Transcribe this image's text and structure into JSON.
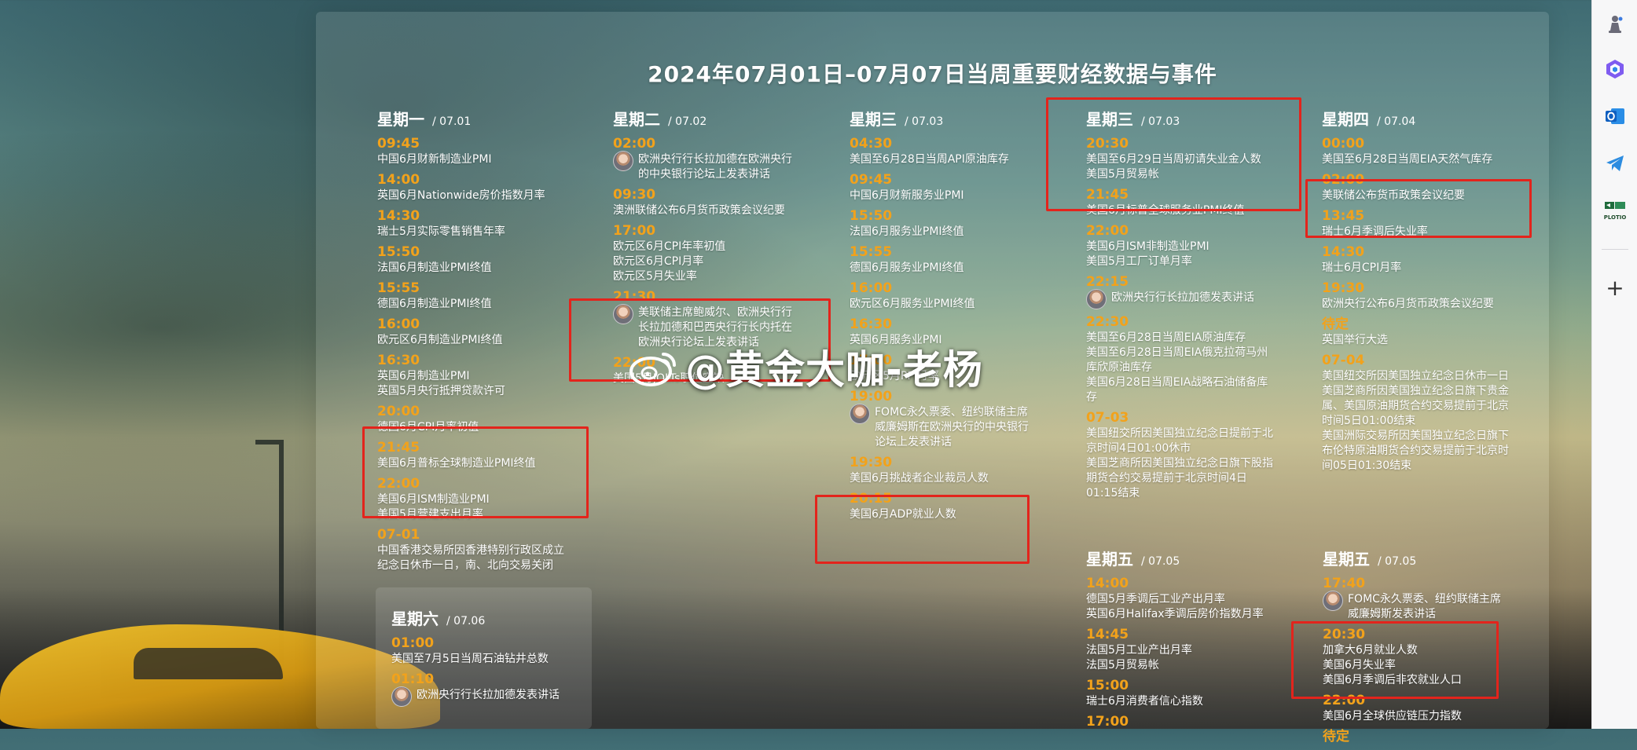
{
  "title": "2024年07月01日–07月07日当周重要财经数据与事件",
  "watermark": "@黄金大咖-老杨",
  "days": [
    {
      "key": "mon",
      "name": "星期一",
      "date": "/ 07.01",
      "events": [
        {
          "time": "09:45",
          "items": [
            "中国6月财新制造业PMI"
          ]
        },
        {
          "time": "14:00",
          "items": [
            "英国6月Nationwide房价指数月率"
          ]
        },
        {
          "time": "14:30",
          "items": [
            "瑞士5月实际零售销售年率"
          ]
        },
        {
          "time": "15:50",
          "items": [
            "法国6月制造业PMI终值"
          ]
        },
        {
          "time": "15:55",
          "items": [
            "德国6月制造业PMI终值"
          ]
        },
        {
          "time": "16:00",
          "items": [
            "欧元区6月制造业PMI终值"
          ]
        },
        {
          "time": "16:30",
          "items": [
            "英国6月制造业PMI",
            "英国5月央行抵押贷款许可"
          ]
        },
        {
          "time": "20:00",
          "items": [
            "德国6月CPI月率初值"
          ]
        },
        {
          "time": "21:45",
          "items": [
            "美国6月普标全球制造业PMI终值"
          ]
        },
        {
          "time": "22:00",
          "items": [
            "美国6月ISM制造业PMI",
            "美国5月营建支出月率"
          ]
        },
        {
          "time": "07-01",
          "items": [
            "中国香港交易所因香港特别行政区成立纪念日休市一日，南、北向交易关闭"
          ]
        }
      ]
    },
    {
      "key": "tue",
      "name": "星期二",
      "date": "/ 07.02",
      "events": [
        {
          "time": "02:00",
          "avatar": true,
          "items": [
            "欧洲央行行长拉加德在欧洲央行的中央银行论坛上发表讲话"
          ]
        },
        {
          "time": "09:30",
          "items": [
            "澳洲联储公布6月货币政策会议纪要"
          ]
        },
        {
          "time": "17:00",
          "items": [
            "欧元区6月CPI年率初值",
            "欧元区6月CPI月率",
            "欧元区5月失业率"
          ]
        },
        {
          "time": "21:30",
          "avatar": true,
          "items": [
            "美联储主席鲍威尔、欧洲央行行长拉加德和巴西央行行长内托在欧洲央行论坛上发表讲话"
          ]
        },
        {
          "time": "22:00",
          "items": [
            "美国5月JOLTs职位空缺"
          ]
        }
      ]
    },
    {
      "key": "wed",
      "name": "星期三",
      "date": "/ 07.03",
      "events": [
        {
          "time": "04:30",
          "items": [
            "美国至6月28日当周API原油库存"
          ]
        },
        {
          "time": "09:45",
          "items": [
            "中国6月财新服务业PMI"
          ]
        },
        {
          "time": "15:50",
          "items": [
            "法国6月服务业PMI终值"
          ]
        },
        {
          "time": "15:55",
          "items": [
            "德国6月服务业PMI终值"
          ]
        },
        {
          "time": "16:00",
          "items": [
            "欧元区6月服务业PMI终值"
          ]
        },
        {
          "time": "16:30",
          "items": [
            "英国6月服务业PMI"
          ]
        },
        {
          "time": "17:00",
          "items": [
            "欧元区5月PPI月率"
          ]
        },
        {
          "time": "19:00",
          "avatar": true,
          "items": [
            "FOMC永久票委、纽约联储主席威廉姆斯在欧洲央行的中央银行论坛上发表讲话"
          ]
        },
        {
          "time": "19:30",
          "items": [
            "美国6月挑战者企业裁员人数"
          ]
        },
        {
          "time": "20:15",
          "items": [
            "美国6月ADP就业人数"
          ]
        }
      ]
    },
    {
      "key": "wed2",
      "name": "星期三",
      "date": "/ 07.03",
      "events": [
        {
          "time": "20:30",
          "items": [
            "美国至6月29日当周初请失业金人数",
            "美国5月贸易帐"
          ]
        },
        {
          "time": "21:45",
          "items": [
            "美国6月标普全球服务业PMI终值"
          ]
        },
        {
          "time": "22:00",
          "items": [
            "美国6月ISM非制造业PMI",
            "美国5月工厂订单月率"
          ]
        },
        {
          "time": "22:15",
          "avatar": true,
          "items": [
            "欧洲央行行长拉加德发表讲话"
          ]
        },
        {
          "time": "22:30",
          "items": [
            "美国至6月28日当周EIA原油库存",
            "美国至6月28日当周EIA俄克拉荷马州库欣原油库存",
            "美国6月28日当周EIA战略石油储备库存"
          ]
        },
        {
          "time": "07-03",
          "items": [
            "美国纽交所因美国独立纪念日提前于北京时间4日01:00休市",
            "美国芝商所因美国独立纪念日旗下股指期货合约交易提前于北京时间4日01:15结束"
          ]
        }
      ]
    },
    {
      "key": "thu",
      "name": "星期四",
      "date": "/ 07.04",
      "events": [
        {
          "time": "00:00",
          "items": [
            "美国至6月28日当周EIA天然气库存"
          ]
        },
        {
          "time": "02:00",
          "items": [
            "美联储公布货币政策会议纪要"
          ]
        },
        {
          "time": "13:45",
          "items": [
            "瑞士6月季调后失业率"
          ]
        },
        {
          "time": "14:30",
          "items": [
            "瑞士6月CPI月率"
          ]
        },
        {
          "time": "19:30",
          "items": [
            "欧洲央行公布6月货币政策会议纪要"
          ]
        },
        {
          "time": "待定",
          "items": [
            "英国举行大选"
          ]
        },
        {
          "time": "07-04",
          "items": [
            "美国纽交所因美国独立纪念日休市一日",
            "美国芝商所因美国独立纪念日旗下贵金属、美国原油期货合约交易提前于北京时间5日01:00结束",
            "美国洲际交易所因美国独立纪念日旗下布伦特原油期货合约交易提前于北京时间05日01:30结束"
          ]
        }
      ]
    },
    {
      "key": "fri",
      "name": "星期五",
      "date": "/ 07.05",
      "events": [
        {
          "time": "14:00",
          "items": [
            "德国5月季调后工业产出月率",
            "英国6月Halifax季调后房价指数月率"
          ]
        },
        {
          "time": "14:45",
          "items": [
            "法国5月工业产出月率",
            "法国5月贸易帐"
          ]
        },
        {
          "time": "15:00",
          "items": [
            "瑞士6月消费者信心指数"
          ]
        },
        {
          "time": "17:00",
          "items": [
            ""
          ]
        }
      ]
    },
    {
      "key": "fri2",
      "name": "星期五",
      "date": "/ 07.05",
      "events": [
        {
          "time": "17:40",
          "avatar": true,
          "items": [
            "FOMC永久票委、纽约联储主席威廉姆斯发表讲话"
          ]
        },
        {
          "time": "20:30",
          "items": [
            "加拿大6月就业人数",
            "美国6月失业率",
            "美国6月季调后非农就业人口"
          ]
        },
        {
          "time": "22:00",
          "items": [
            "美国6月全球供应链压力指数"
          ]
        },
        {
          "time": "待定",
          "items": [
            ""
          ]
        }
      ]
    },
    {
      "key": "sat",
      "name": "星期六",
      "date": "/ 07.06",
      "events": [
        {
          "time": "01:00",
          "items": [
            "美国至7月5日当周石油钻井总数"
          ]
        },
        {
          "time": "01:10",
          "avatar": true,
          "items": [
            "欧洲央行行长拉加德发表讲话"
          ]
        }
      ]
    }
  ],
  "sidebar": {
    "items": [
      {
        "name": "chess-icon"
      },
      {
        "name": "copilot-icon"
      },
      {
        "name": "outlook-icon"
      },
      {
        "name": "telegram-icon"
      },
      {
        "name": "plotio-icon",
        "label": "PLOTIO"
      }
    ],
    "add_label": "+"
  },
  "colors": {
    "time": "#f2a21b",
    "highlight": "#e3241c",
    "title": "#ffffff"
  }
}
